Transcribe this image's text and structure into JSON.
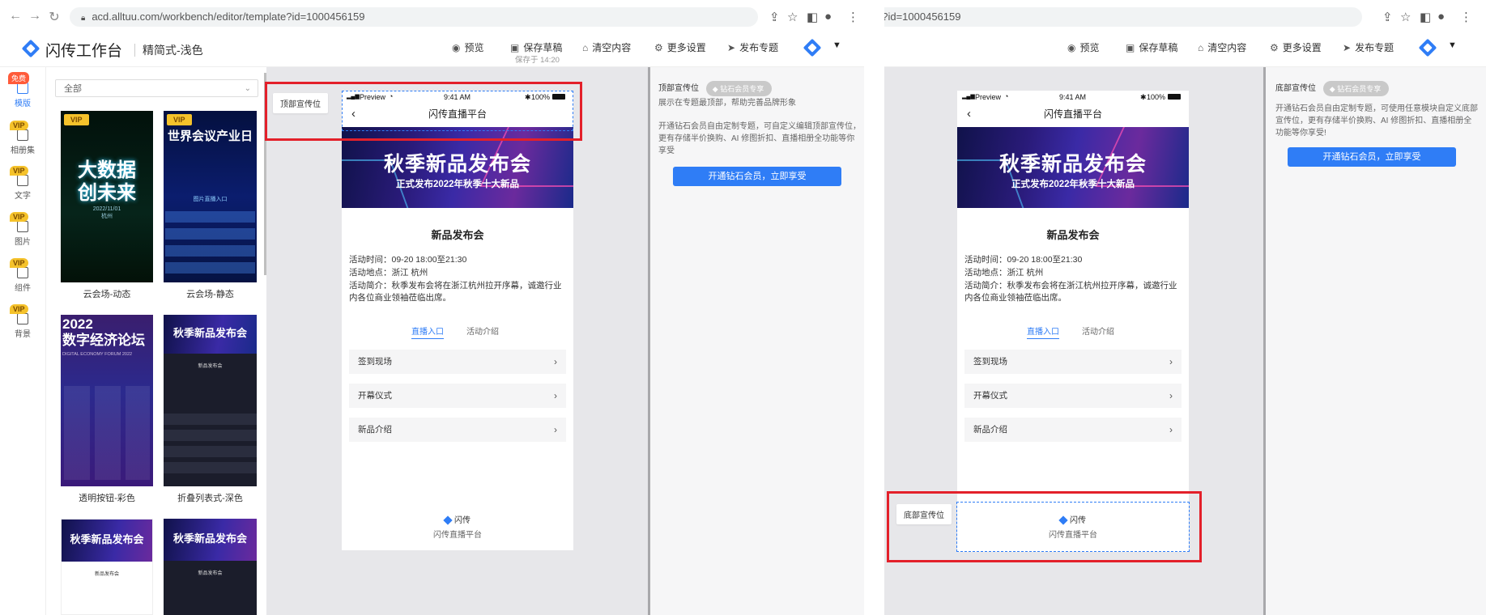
{
  "browser": {
    "url_left": "acd.alltuu.com/workbench/editor/template?id=1000456159",
    "url_right": "e?id=1000456159"
  },
  "app": {
    "brand": "闪传工作台",
    "template_name": "精简式-浅色",
    "actions": {
      "preview": "预览",
      "save_draft": "保存草稿",
      "saved_time": "保存于 14:20",
      "clear": "清空内容",
      "more_settings": "更多设置",
      "publish": "发布专题"
    }
  },
  "sidebar": {
    "items": [
      {
        "label": "模版",
        "badge": "免费"
      },
      {
        "label": "相册集",
        "badge": "VIP"
      },
      {
        "label": "文字",
        "badge": "VIP"
      },
      {
        "label": "图片",
        "badge": "VIP"
      },
      {
        "label": "组件",
        "badge": "VIP"
      },
      {
        "label": "背景",
        "badge": "VIP"
      }
    ]
  },
  "templates": {
    "filter": "全部",
    "items": [
      {
        "label": "云会场-动态",
        "vip": "VIP",
        "thumb_title": "大数据\n创未来",
        "thumb_sub": "2022/11/01\n杭州"
      },
      {
        "label": "云会场-静态",
        "vip": "VIP",
        "thumb_title": "世界会议产业日",
        "thumb_sub": "图片直播入口"
      },
      {
        "label": "透明按钮-彩色",
        "thumb_title": "2022\n数字经济论坛",
        "thumb_sub": "DIGITAL ECONOMY FORUM 2022"
      },
      {
        "label": "折叠列表式-深色",
        "thumb_title": "秋季新品发布会",
        "thumb_sub": "新品发布会"
      },
      {
        "label": "",
        "thumb_title": "秋季新品发布会",
        "thumb_sub": "新品发布会"
      },
      {
        "label": "",
        "thumb_title": "秋季新品发布会",
        "thumb_sub": "新品发布会"
      }
    ]
  },
  "phone": {
    "carrier": "Preview",
    "time": "9:41 AM",
    "battery": "100%",
    "nav_title": "闪传直播平台",
    "banner_title": "秋季新品发布会",
    "banner_sub": "正式发布2022年秋季十大新品",
    "event_title": "新品发布会",
    "time_line": "活动时间：09-20 18:00至21:30",
    "place_line": "活动地点：浙江 杭州",
    "intro_line": "活动简介：秋季发布会将在浙江杭州拉开序幕，诚邀行业内各位商业领袖莅临出席。",
    "tab_live": "直播入口",
    "tab_intro": "活动介绍",
    "list": [
      "签到现场",
      "开幕仪式",
      "新品介绍"
    ],
    "footer_brand": "闪传",
    "footer_sub": "闪传直播平台"
  },
  "left_panel": {
    "slot_label": "顶部宣传位",
    "prop_title": "顶部宣传位",
    "badge": "钻石会员专享",
    "desc1": "展示在专题最顶部，帮助完善品牌形象",
    "desc2": "开通钻石会员自由定制专题，可自定义编辑顶部宣传位，更有存储半价换购、AI 修图折扣、直播相册全功能等你享受",
    "button": "开通钻石会员，立即享受"
  },
  "right_panel": {
    "slot_label": "底部宣传位",
    "prop_title": "底部宣传位",
    "badge": "钻石会员专享",
    "desc": "开通钻石会员自由定制专题，可使用任意模块自定义底部宣传位，更有存储半价换购、AI 修图折扣、直播相册全功能等你享受!",
    "button": "开通钻石会员，立即享受"
  },
  "colors": {
    "accent": "#2f7df6",
    "highlight": "#e3202a",
    "vip": "#f5c22b"
  }
}
